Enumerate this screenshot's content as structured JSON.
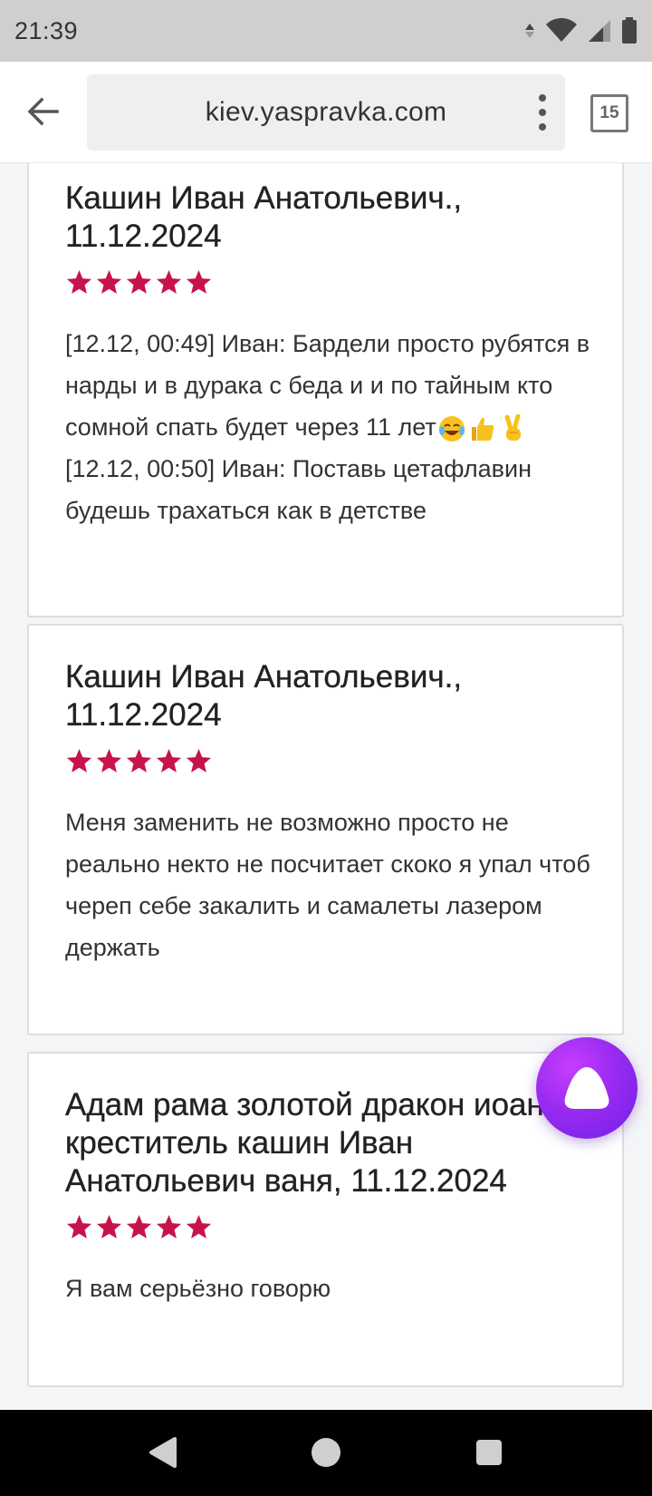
{
  "status_bar": {
    "time": "21:39"
  },
  "browser": {
    "url": "kiev.yaspravka.com",
    "tab_count": "15"
  },
  "reviews": [
    {
      "title": "Кашин Иван Анатольевич., 11.12.2024",
      "rating": 5,
      "text_parts": [
        "[12.12, 00:49] Иван: Бардели просто рубятся в нарды и в дурака с беда и и по тайным кто сомной спать будет через 11 лет",
        " [12.12, 00:50] Иван: Поставь цетафлавин будешь трахаться как в детстве"
      ],
      "emojis": [
        "face-with-tears-of-joy",
        "thumbs-up",
        "victory-hand"
      ]
    },
    {
      "title": "Кашин Иван Анатольевич., 11.12.2024",
      "rating": 5,
      "text": "Меня заменить не возможно просто не реально некто не посчитает скоко я упал чтоб череп себе закалить и самалеты лазером держать"
    },
    {
      "title": "Адам рама золотой дракон иоан креститель кашин Иван Анатольевич ваня, 11.12.2024",
      "rating": 5,
      "text": "Я вам серьёзно говорю"
    }
  ],
  "colors": {
    "star": "#c8124a",
    "assistant": "#9a2bf0"
  }
}
